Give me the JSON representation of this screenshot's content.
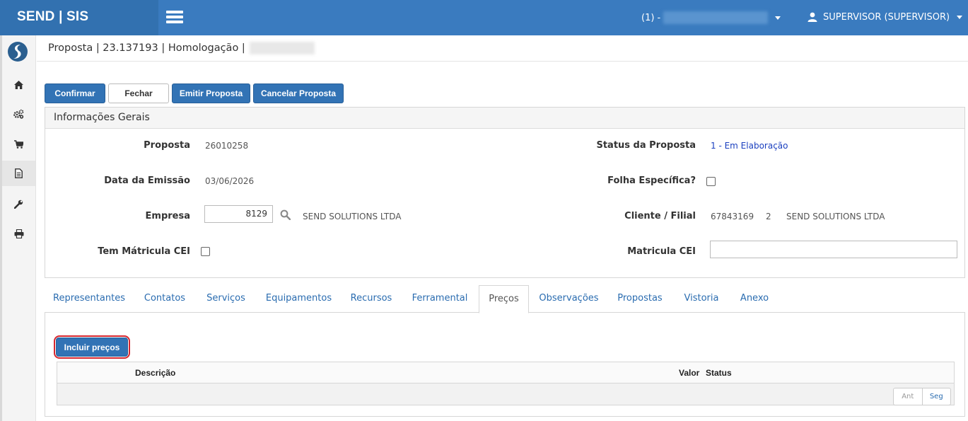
{
  "topbar": {
    "brand": "SEND | SIS",
    "company_label": "(1) -",
    "user_label": "SUPERVISOR (SUPERVISOR)"
  },
  "sidebar": {
    "items": [
      {
        "icon": "home-icon"
      },
      {
        "icon": "gears-icon"
      },
      {
        "icon": "cart-icon"
      },
      {
        "icon": "document-icon"
      },
      {
        "icon": "wrench-icon"
      },
      {
        "icon": "print-icon"
      }
    ]
  },
  "breadcrumb": {
    "text": "Proposta | 23.137193 | Homologação |"
  },
  "toolbar": {
    "confirm_label": "Confirmar",
    "close_label": "Fechar",
    "emit_label": "Emitir Proposta",
    "cancel_label": "Cancelar Proposta"
  },
  "panel": {
    "title": "Informações Gerais",
    "proposta_label": "Proposta",
    "proposta_value": "26010258",
    "data_label": "Data da Emissão",
    "data_value": "03/06/2026",
    "empresa_label": "Empresa",
    "empresa_code": "8129",
    "empresa_name": "SEND SOLUTIONS LTDA",
    "cei_label": "Tem Mátricula CEI",
    "status_label": "Status da Proposta",
    "status_value": "1 - Em Elaboração",
    "folha_label": "Folha Específica?",
    "cliente_label": "Cliente / Filial",
    "cliente_code": "67843169",
    "cliente_filial": "2",
    "cliente_name": "SEND SOLUTIONS LTDA",
    "matricula_label": "Matricula CEI",
    "matricula_value": ""
  },
  "tabs": [
    {
      "label": "Representantes"
    },
    {
      "label": "Contatos"
    },
    {
      "label": "Serviços"
    },
    {
      "label": "Equipamentos"
    },
    {
      "label": "Recursos"
    },
    {
      "label": "Ferramental"
    },
    {
      "label": "Preços"
    },
    {
      "label": "Observações"
    },
    {
      "label": "Propostas"
    },
    {
      "label": "Vistoria"
    },
    {
      "label": "Anexo"
    }
  ],
  "precos": {
    "include_label": "Incluir preços",
    "columns": [
      "Descrição",
      "Valor",
      "Status"
    ],
    "pager_prev": "Ant",
    "pager_next": "Seg"
  },
  "colors": {
    "topbar": "#3a7bbf",
    "brand_bg": "#3271b0",
    "primary": "#3273b5",
    "highlight_ring": "#d6262e",
    "status_link": "#1a3fbf"
  }
}
